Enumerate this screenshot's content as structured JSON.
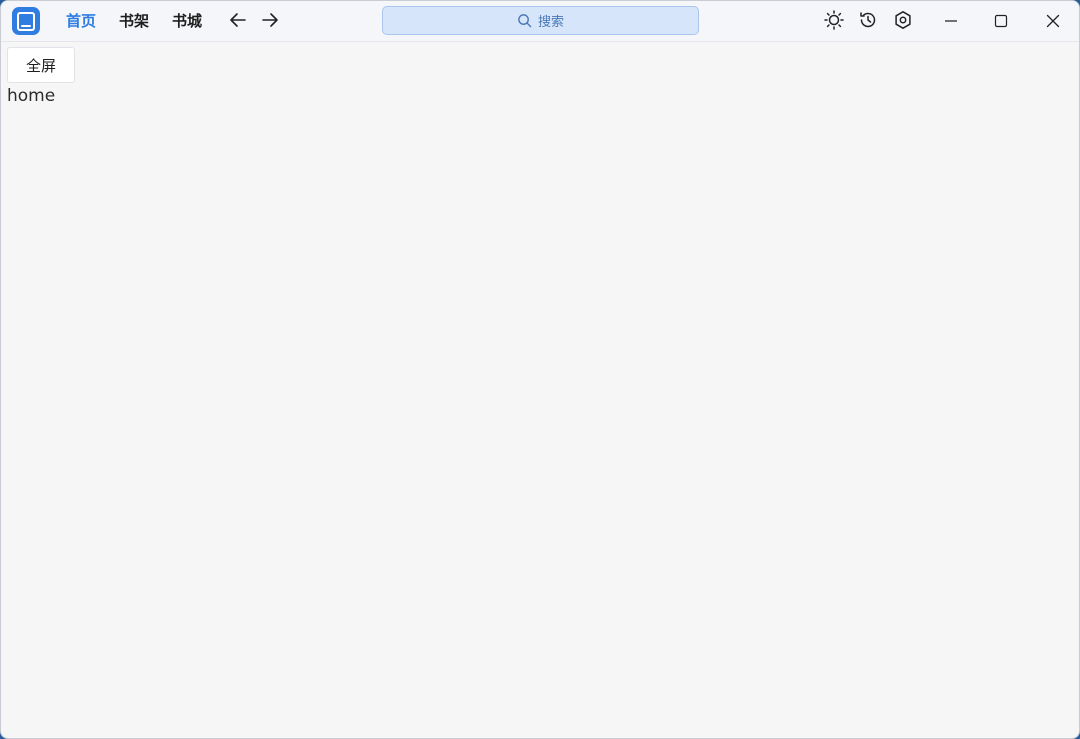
{
  "titlebar": {
    "tabs": [
      {
        "label": "首页",
        "active": true
      },
      {
        "label": "书架",
        "active": false
      },
      {
        "label": "书城",
        "active": false
      }
    ],
    "back_icon": "arrow-left-icon",
    "forward_icon": "arrow-right-icon",
    "search": {
      "placeholder": "搜索",
      "icon": "search-icon"
    },
    "tools": [
      "theme-sun-icon",
      "history-icon",
      "settings-icon"
    ],
    "window_controls": [
      "minimize-icon",
      "maximize-icon",
      "close-icon"
    ]
  },
  "main": {
    "fullscreen_label": "全屏",
    "route_text": "home"
  },
  "colors": {
    "accent": "#2f7de1",
    "search_bg": "#d6e5f9",
    "page_bg": "#f6f6f7"
  }
}
